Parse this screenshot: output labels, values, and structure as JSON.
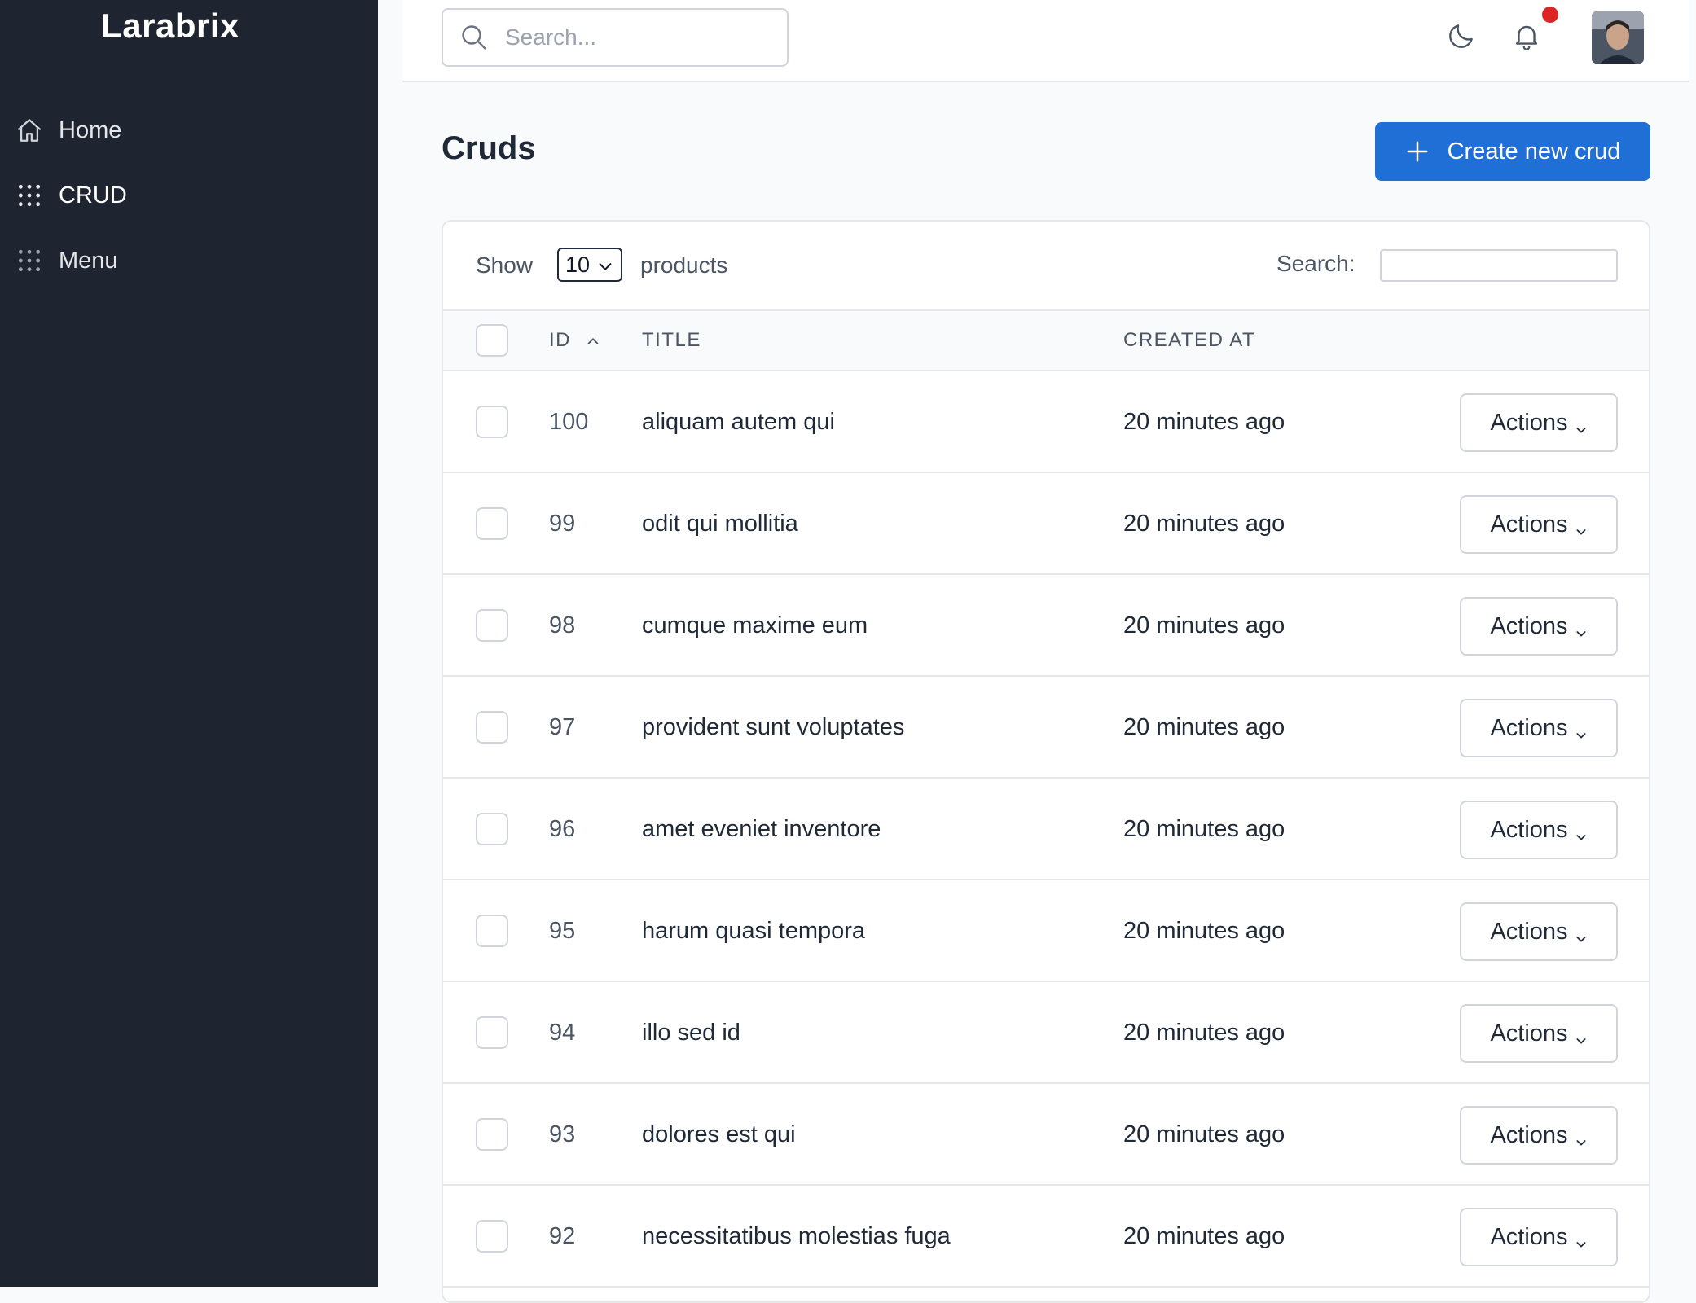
{
  "app": {
    "brand": "Larabrix"
  },
  "sidebar": {
    "items": [
      {
        "label": "Home",
        "icon": "home-icon"
      },
      {
        "label": "CRUD",
        "icon": "grid-dots-icon"
      },
      {
        "label": "Menu",
        "icon": "grid-dots-icon"
      }
    ]
  },
  "header": {
    "search_placeholder": "Search...",
    "icons": [
      "moon-icon",
      "bell-icon"
    ],
    "notification_dot_color": "#dc2626"
  },
  "page": {
    "title": "Cruds",
    "create_button_label": "Create new crud",
    "accent_color": "#1f6fd6"
  },
  "table": {
    "show_label": "Show",
    "page_size": "10",
    "entity_label": "products",
    "search_label": "Search:",
    "columns": {
      "id": "ID",
      "title": "TITLE",
      "created_at": "CREATED AT"
    },
    "sort": {
      "column": "ID",
      "direction": "ascending"
    },
    "action_label": "Actions",
    "rows": [
      {
        "id": "100",
        "title": "aliquam autem qui",
        "created_at": "20 minutes ago"
      },
      {
        "id": "99",
        "title": "odit qui mollitia",
        "created_at": "20 minutes ago"
      },
      {
        "id": "98",
        "title": "cumque maxime eum",
        "created_at": "20 minutes ago"
      },
      {
        "id": "97",
        "title": "provident sunt voluptates",
        "created_at": "20 minutes ago"
      },
      {
        "id": "96",
        "title": "amet eveniet inventore",
        "created_at": "20 minutes ago"
      },
      {
        "id": "95",
        "title": "harum quasi tempora",
        "created_at": "20 minutes ago"
      },
      {
        "id": "94",
        "title": "illo sed id",
        "created_at": "20 minutes ago"
      },
      {
        "id": "93",
        "title": "dolores est qui",
        "created_at": "20 minutes ago"
      },
      {
        "id": "92",
        "title": "necessitatibus molestias fuga",
        "created_at": "20 minutes ago"
      }
    ]
  }
}
